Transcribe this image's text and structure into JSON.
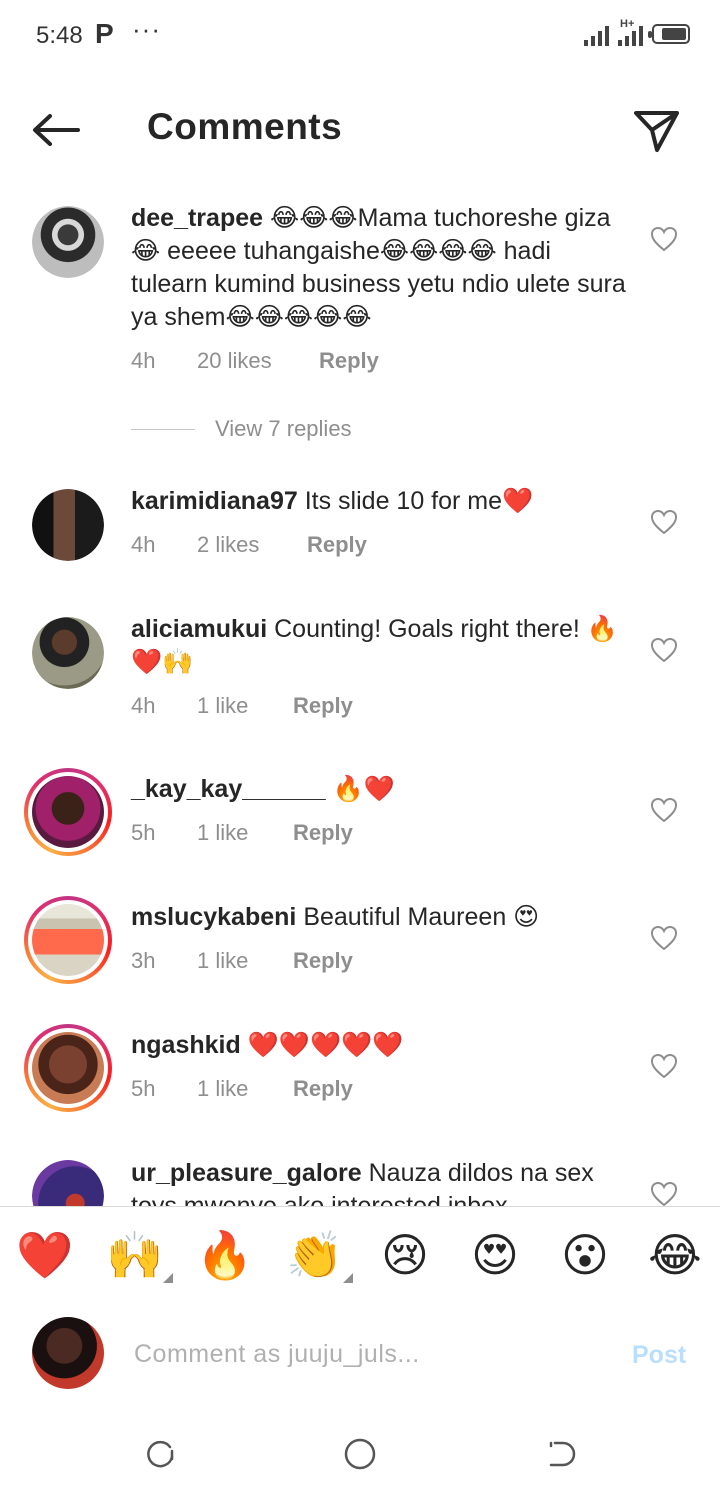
{
  "status_bar": {
    "time": "5:48",
    "app_icon": "P",
    "more": "···",
    "network_badge": "H+",
    "icons": [
      "signal-icon",
      "signal-icon",
      "battery-icon"
    ]
  },
  "header": {
    "title": "Comments",
    "back_icon": "arrow-left-icon",
    "send_icon": "paper-plane-icon"
  },
  "comments": [
    {
      "username": "dee_trapee",
      "text": "😂😂😂Mama tuchoreshe giza😂 eeeee tuhangaishe😂😂😂😂 hadi tulearn kumind business yetu ndio ulete sura ya shem😂😂😂😂😂",
      "time": "4h",
      "likes": "20 likes",
      "reply": "Reply",
      "view_replies": "View 7 replies"
    },
    {
      "username": "karimidiana97",
      "text": "Its slide 10 for me❤️",
      "time": "4h",
      "likes": "2 likes",
      "reply": "Reply"
    },
    {
      "username": "aliciamukui",
      "text": "Counting! Goals right there! 🔥❤️🙌",
      "time": "4h",
      "likes": "1 like",
      "reply": "Reply"
    },
    {
      "username": "_kay_kay______",
      "text": "🔥❤️",
      "time": "5h",
      "likes": "1 like",
      "reply": "Reply"
    },
    {
      "username": "mslucykabeni",
      "text": "Beautiful Maureen 😍",
      "time": "3h",
      "likes": "1 like",
      "reply": "Reply"
    },
    {
      "username": "ngashkid",
      "text": "❤️❤️❤️❤️❤️",
      "time": "5h",
      "likes": "1 like",
      "reply": "Reply"
    },
    {
      "username": "ur_pleasure_galore",
      "text": "Nauza dildos na sex toys mwenye ako interested inbox"
    }
  ],
  "emoji_bar": [
    "❤️",
    "🙌",
    "🔥",
    "👏",
    "😢",
    "😍",
    "😮",
    "😂"
  ],
  "compose": {
    "placeholder": "Comment as juuju_juls...",
    "post_label": "Post"
  },
  "colors": {
    "text": "#262626",
    "secondary": "#8e8e8e",
    "post_disabled": "#b9dffc",
    "story_ring": "#e1306c"
  }
}
